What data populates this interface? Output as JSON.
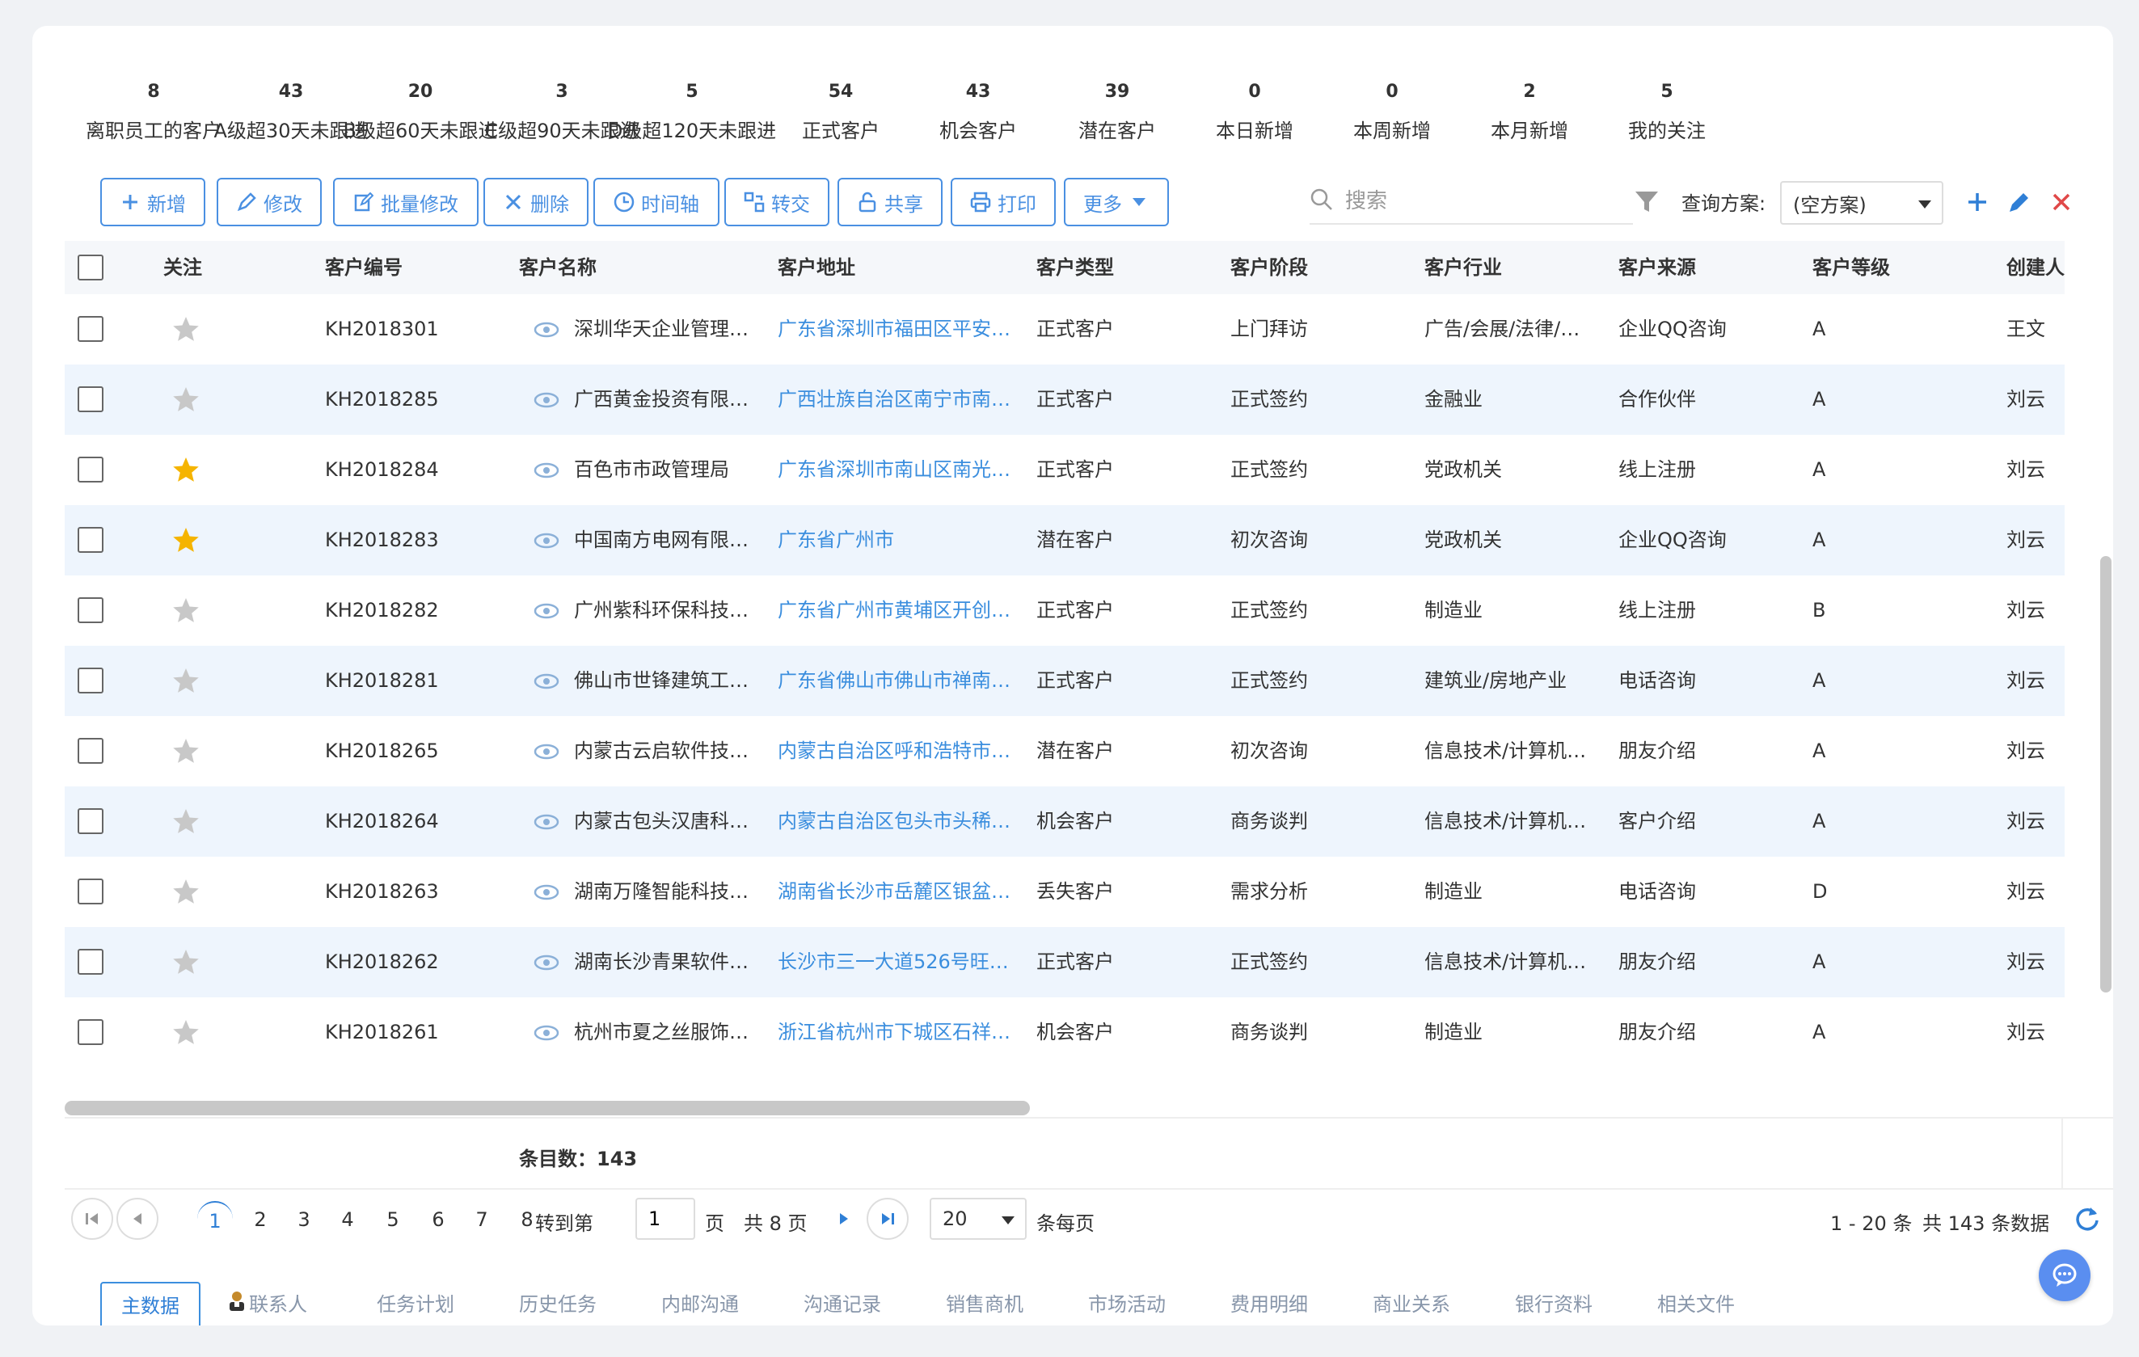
{
  "stats": [
    {
      "count": "8",
      "label": "离职员工的客户"
    },
    {
      "count": "43",
      "label": "A级超30天未跟进"
    },
    {
      "count": "20",
      "label": "B级超60天未跟进"
    },
    {
      "count": "3",
      "label": "C级超90天未跟进"
    },
    {
      "count": "5",
      "label": "D级超120天未跟进"
    },
    {
      "count": "54",
      "label": "正式客户"
    },
    {
      "count": "43",
      "label": "机会客户"
    },
    {
      "count": "39",
      "label": "潜在客户"
    },
    {
      "count": "0",
      "label": "本日新增"
    },
    {
      "count": "0",
      "label": "本周新增"
    },
    {
      "count": "2",
      "label": "本月新增"
    },
    {
      "count": "5",
      "label": "我的关注"
    }
  ],
  "toolbar": {
    "add": "新增",
    "edit": "修改",
    "batch_edit": "批量修改",
    "delete": "删除",
    "timeline": "时间轴",
    "transfer": "转交",
    "share": "共享",
    "print": "打印",
    "more": "更多"
  },
  "search": {
    "placeholder": "搜索"
  },
  "scheme": {
    "label": "查询方案:",
    "value": "(空方案)"
  },
  "columns": {
    "follow": "关注",
    "code": "客户编号",
    "name": "客户名称",
    "address": "客户地址",
    "type": "客户类型",
    "stage": "客户阶段",
    "industry": "客户行业",
    "source": "客户来源",
    "level": "客户等级",
    "creator": "创建人"
  },
  "rows": [
    {
      "starred": false,
      "code": "KH2018301",
      "name": "深圳华天企业管理…",
      "address": "广东省深圳市福田区平安…",
      "type": "正式客户",
      "stage": "上门拜访",
      "industry": "广告/会展/法律/…",
      "source": "企业QQ咨询",
      "level": "A",
      "creator": "王文"
    },
    {
      "starred": false,
      "code": "KH2018285",
      "name": "广西黄金投资有限…",
      "address": "广西壮族自治区南宁市南…",
      "type": "正式客户",
      "stage": "正式签约",
      "industry": "金融业",
      "source": "合作伙伴",
      "level": "A",
      "creator": "刘云"
    },
    {
      "starred": true,
      "code": "KH2018284",
      "name": "百色市市政管理局",
      "address": "广东省深圳市南山区南光…",
      "type": "正式客户",
      "stage": "正式签约",
      "industry": "党政机关",
      "source": "线上注册",
      "level": "A",
      "creator": "刘云"
    },
    {
      "starred": true,
      "code": "KH2018283",
      "name": "中国南方电网有限…",
      "address": "广东省广州市",
      "type": "潜在客户",
      "stage": "初次咨询",
      "industry": "党政机关",
      "source": "企业QQ咨询",
      "level": "A",
      "creator": "刘云"
    },
    {
      "starred": false,
      "code": "KH2018282",
      "name": "广州紫科环保科技…",
      "address": "广东省广州市黄埔区开创…",
      "type": "正式客户",
      "stage": "正式签约",
      "industry": "制造业",
      "source": "线上注册",
      "level": "B",
      "creator": "刘云"
    },
    {
      "starred": false,
      "code": "KH2018281",
      "name": "佛山市世锋建筑工…",
      "address": "广东省佛山市佛山市禅南…",
      "type": "正式客户",
      "stage": "正式签约",
      "industry": "建筑业/房地产业",
      "source": "电话咨询",
      "level": "A",
      "creator": "刘云"
    },
    {
      "starred": false,
      "code": "KH2018265",
      "name": "内蒙古云启软件技…",
      "address": "内蒙古自治区呼和浩特市…",
      "type": "潜在客户",
      "stage": "初次咨询",
      "industry": "信息技术/计算机…",
      "source": "朋友介绍",
      "level": "A",
      "creator": "刘云"
    },
    {
      "starred": false,
      "code": "KH2018264",
      "name": "内蒙古包头汉唐科…",
      "address": "内蒙古自治区包头市头稀…",
      "type": "机会客户",
      "stage": "商务谈判",
      "industry": "信息技术/计算机…",
      "source": "客户介绍",
      "level": "A",
      "creator": "刘云"
    },
    {
      "starred": false,
      "code": "KH2018263",
      "name": "湖南万隆智能科技…",
      "address": "湖南省长沙市岳麓区银盆…",
      "type": "丢失客户",
      "stage": "需求分析",
      "industry": "制造业",
      "source": "电话咨询",
      "level": "D",
      "creator": "刘云"
    },
    {
      "starred": false,
      "code": "KH2018262",
      "name": "湖南长沙青果软件…",
      "address": "长沙市三一大道526号旺…",
      "type": "正式客户",
      "stage": "正式签约",
      "industry": "信息技术/计算机…",
      "source": "朋友介绍",
      "level": "A",
      "creator": "刘云"
    },
    {
      "starred": false,
      "code": "KH2018261",
      "name": "杭州市夏之丝服饰…",
      "address": "浙江省杭州市下城区石祥…",
      "type": "机会客户",
      "stage": "商务谈判",
      "industry": "制造业",
      "source": "朋友介绍",
      "level": "A",
      "creator": "刘云"
    }
  ],
  "summary": {
    "label": "条目数：",
    "value": "143"
  },
  "pagination": {
    "pages": [
      "1",
      "2",
      "3",
      "4",
      "5",
      "6",
      "7",
      "8"
    ],
    "current": "1",
    "goto_label": "转到第",
    "goto_value": "1",
    "page_unit": "页",
    "total_pages": "共 8 页",
    "page_size": "20",
    "per_page_label": "条每页",
    "range": "1 - 20 条",
    "total": "共 143 条数据"
  },
  "tabs": [
    "主数据",
    "联系人",
    "任务计划",
    "历史任务",
    "内邮沟通",
    "沟通记录",
    "销售商机",
    "市场活动",
    "费用明细",
    "商业关系",
    "银行资料",
    "相关文件"
  ],
  "colors": {
    "accent": "#3b8ede",
    "star_on": "#f5b400",
    "star_off": "#c8c8c8",
    "row_alt": "#eef5fd"
  }
}
